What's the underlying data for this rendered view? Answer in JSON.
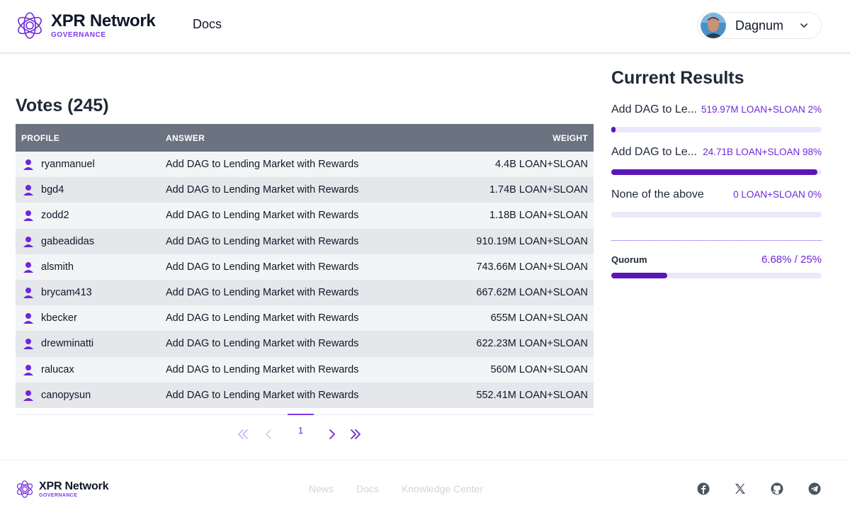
{
  "header": {
    "brand_name": "XPR Network",
    "brand_sub": "GOVERNANCE",
    "nav_docs": "Docs",
    "user_name": "Dagnum"
  },
  "votes": {
    "title": "Votes (245)",
    "columns": [
      "PROFILE",
      "ANSWER",
      "WEIGHT"
    ],
    "rows": [
      {
        "profile": "ryanmanuel",
        "answer": "Add DAG to Lending Market with Rewards",
        "weight": "4.4B LOAN+SLOAN"
      },
      {
        "profile": "bgd4",
        "answer": "Add DAG to Lending Market with Rewards",
        "weight": "1.74B LOAN+SLOAN"
      },
      {
        "profile": "zodd2",
        "answer": "Add DAG to Lending Market with Rewards",
        "weight": "1.18B LOAN+SLOAN"
      },
      {
        "profile": "gabeadidas",
        "answer": "Add DAG to Lending Market with Rewards",
        "weight": "910.19M LOAN+SLOAN"
      },
      {
        "profile": "alsmith",
        "answer": "Add DAG to Lending Market with Rewards",
        "weight": "743.66M LOAN+SLOAN"
      },
      {
        "profile": "brycam413",
        "answer": "Add DAG to Lending Market with Rewards",
        "weight": "667.62M LOAN+SLOAN"
      },
      {
        "profile": "kbecker",
        "answer": "Add DAG to Lending Market with Rewards",
        "weight": "655M LOAN+SLOAN"
      },
      {
        "profile": "drewminatti",
        "answer": "Add DAG to Lending Market with Rewards",
        "weight": "622.23M LOAN+SLOAN"
      },
      {
        "profile": "ralucax",
        "answer": "Add DAG to Lending Market with Rewards",
        "weight": "560M LOAN+SLOAN"
      },
      {
        "profile": "canopysun",
        "answer": "Add DAG to Lending Market with Rewards",
        "weight": "552.41M LOAN+SLOAN"
      }
    ],
    "pagination": {
      "current_page": "1"
    }
  },
  "results": {
    "title": "Current Results",
    "options": [
      {
        "label": "Add DAG to Le...",
        "value": "519.97M LOAN+SLOAN 2%",
        "fraction": 0.02
      },
      {
        "label": "Add DAG to Le...",
        "value": "24.71B LOAN+SLOAN 98%",
        "fraction": 0.98
      },
      {
        "label": "None of the above",
        "value": "0 LOAN+SLOAN 0%",
        "fraction": 0
      }
    ],
    "quorum": {
      "label": "Quorum",
      "value": "6.68% / 25%",
      "fraction": 0.2672
    }
  },
  "footer": {
    "brand_name": "XPR Network",
    "brand_sub": "GOVERNANCE",
    "links": [
      "News",
      "Docs",
      "Knowledge Center"
    ],
    "social_icons": [
      "facebook-icon",
      "x-icon",
      "github-icon",
      "telegram-icon"
    ]
  },
  "colors": {
    "accent": "#6d28d9",
    "bar_fill": "#5b16b8",
    "bar_track": "#ebe8fb",
    "table_header": "#6b7280"
  }
}
